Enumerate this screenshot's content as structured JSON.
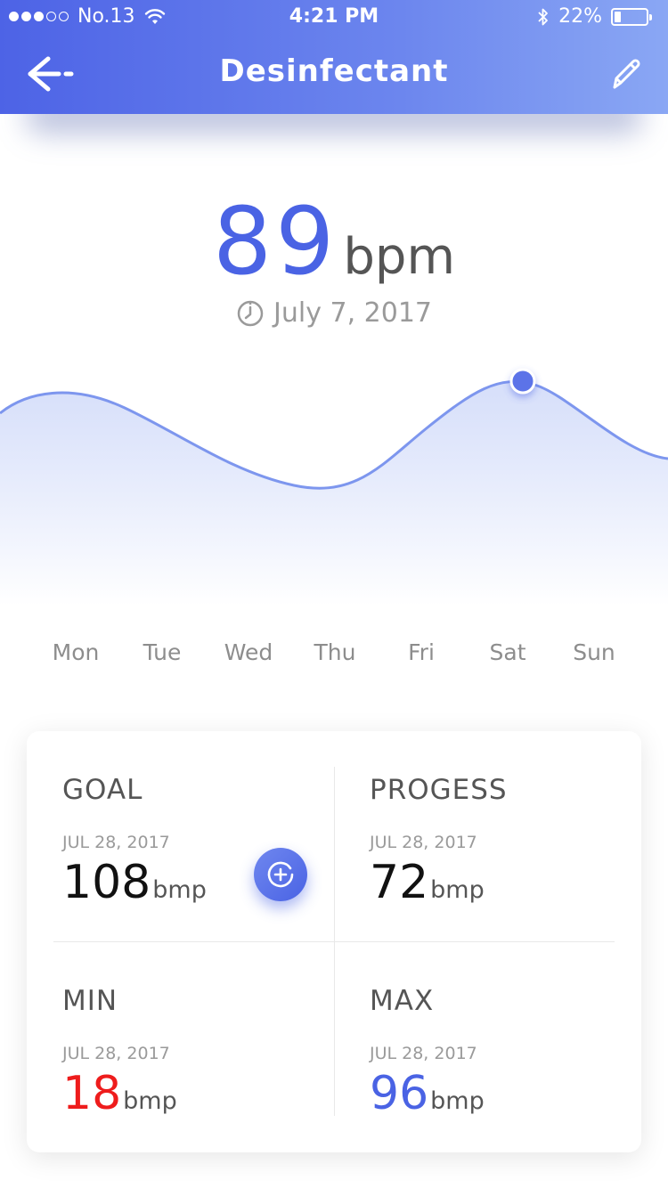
{
  "status_bar": {
    "carrier": "No.13",
    "time": "4:21 PM",
    "battery_percent": "22%",
    "battery_level": 0.22,
    "signal_bars_filled": 3,
    "signal_bars_total": 5
  },
  "nav": {
    "title": "Desinfectant",
    "back_icon": "back-arrow-icon",
    "edit_icon": "pencil-icon"
  },
  "reading": {
    "value": "89",
    "unit": "bpm",
    "date": "July 7, 2017"
  },
  "chart_data": {
    "type": "area",
    "categories": [
      "Mon",
      "Tue",
      "Wed",
      "Thu",
      "Fri",
      "Sat",
      "Sun"
    ],
    "highlight_index": 5,
    "accent_color": "#4a63e4",
    "line_color": "#7d96ee"
  },
  "stats": {
    "goal": {
      "title": "GOAL",
      "date": "JUL 28, 2017",
      "value": "108",
      "unit": "bmp",
      "color": "#111111"
    },
    "progress": {
      "title": "PROGESS",
      "date": "JUL 28, 2017",
      "value": "72",
      "unit": "bmp",
      "color": "#111111"
    },
    "min": {
      "title": "MIN",
      "date": "JUL 28, 2017",
      "value": "18",
      "unit": "bmp",
      "color": "#ee1c1c"
    },
    "max": {
      "title": "MAX",
      "date": "JUL 28, 2017",
      "value": "96",
      "unit": "bmp",
      "color": "#4a63e4"
    }
  },
  "colors": {
    "primary": "#4a63e4",
    "header_gradient_end": "#8aa7f4"
  }
}
